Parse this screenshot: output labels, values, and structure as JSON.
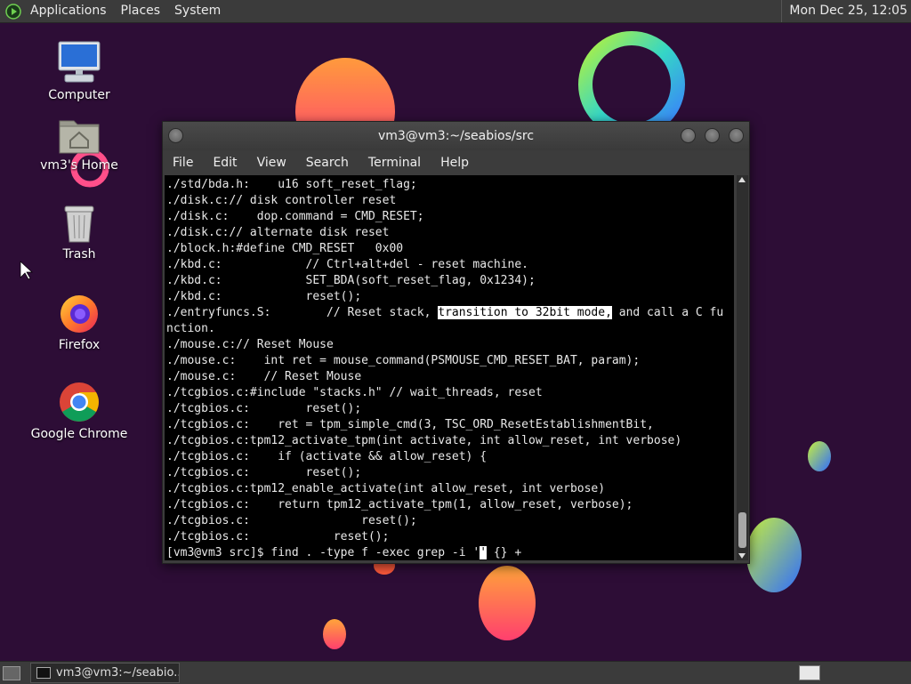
{
  "top_panel": {
    "menus": [
      "Applications",
      "Places",
      "System"
    ],
    "clock": "Mon Dec 25, 12:05"
  },
  "desktop": {
    "icons": [
      {
        "label": "Computer",
        "icon": "computer-icon"
      },
      {
        "label": "vm3's Home",
        "icon": "home-folder-icon"
      },
      {
        "label": "Trash",
        "icon": "trash-icon"
      },
      {
        "label": "Firefox",
        "icon": "firefox-icon"
      },
      {
        "label": "Google Chrome",
        "icon": "chrome-icon"
      }
    ]
  },
  "terminal": {
    "title": "vm3@vm3:~/seabios/src",
    "menu": [
      "File",
      "Edit",
      "View",
      "Search",
      "Terminal",
      "Help"
    ],
    "lines": [
      "./std/bda.h:    u16 soft_reset_flag;",
      "./disk.c:// disk controller reset",
      "./disk.c:    dop.command = CMD_RESET;",
      "./disk.c:// alternate disk reset",
      "./block.h:#define CMD_RESET   0x00",
      "./kbd.c:            // Ctrl+alt+del - reset machine.",
      "./kbd.c:            SET_BDA(soft_reset_flag, 0x1234);",
      "./kbd.c:            reset();"
    ],
    "highlight_line": {
      "before": "./entryfuncs.S:        // Reset stack, ",
      "selected": "transition to 32bit mode,",
      "after": " and call a C fu"
    },
    "lines_after": [
      "nction.",
      "./mouse.c:// Reset Mouse",
      "./mouse.c:    int ret = mouse_command(PSMOUSE_CMD_RESET_BAT, param);",
      "./mouse.c:    // Reset Mouse",
      "./tcgbios.c:#include \"stacks.h\" // wait_threads, reset",
      "./tcgbios.c:        reset();",
      "./tcgbios.c:    ret = tpm_simple_cmd(3, TSC_ORD_ResetEstablishmentBit,",
      "./tcgbios.c:tpm12_activate_tpm(int activate, int allow_reset, int verbose)",
      "./tcgbios.c:    if (activate && allow_reset) {",
      "./tcgbios.c:        reset();",
      "./tcgbios.c:tpm12_enable_activate(int allow_reset, int verbose)",
      "./tcgbios.c:    return tpm12_activate_tpm(1, allow_reset, verbose);",
      "./tcgbios.c:                reset();",
      "./tcgbios.c:            reset();"
    ],
    "prompt": {
      "before": "[vm3@vm3 src]$ find . -type f -exec grep -i '",
      "cursor": "'",
      "after": " {} +"
    }
  },
  "taskbar": {
    "window_label": "vm3@vm3:~/seabio..."
  }
}
